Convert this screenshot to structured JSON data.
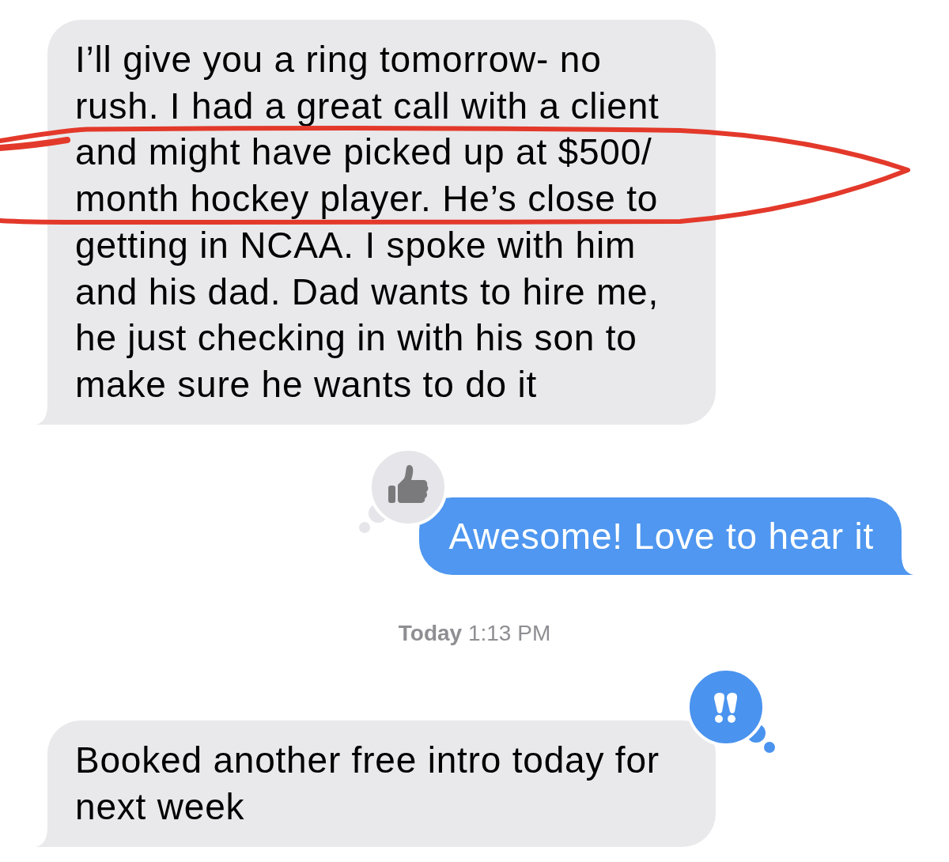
{
  "messages": [
    {
      "kind": "incoming",
      "text": "I’ll give you a ring tomorrow- no rush. I had a great call with a client and might have picked up at $500/ month hockey player. He’s close to getting in NCAA. I spoke with him and his dad. Dad wants to hire me, he just checking in with his son to make sure he wants to do it",
      "circled": true
    },
    {
      "kind": "outgoing",
      "text": "Awesome! Love to hear it",
      "circled": false,
      "tapback": {
        "kind": "thumbs-up",
        "mine": false
      }
    },
    {
      "kind": "timestamp",
      "text": "**Today** 1:13 PM",
      "circled": false
    },
    {
      "kind": "incoming",
      "text": "Booked another free intro today for next week",
      "circled": false,
      "tapback": {
        "kind": "exclamation",
        "mine": true
      }
    }
  ]
}
